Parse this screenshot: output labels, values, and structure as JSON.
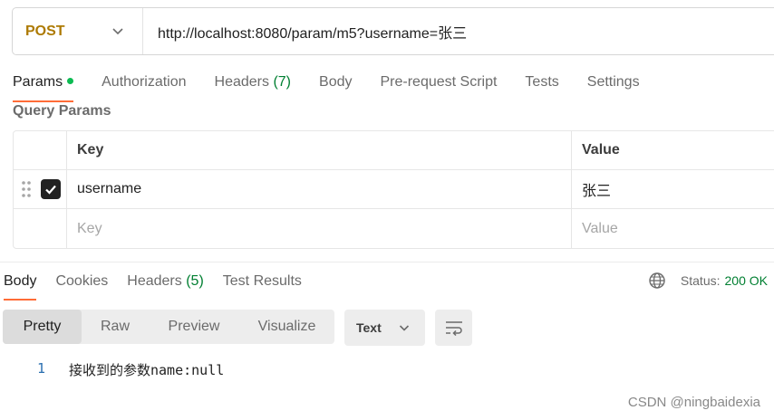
{
  "request": {
    "method": "POST",
    "url": "http://localhost:8080/param/m5?username=张三"
  },
  "request_tabs": [
    {
      "label": "Params",
      "active": true,
      "dot": true
    },
    {
      "label": "Authorization"
    },
    {
      "label": "Headers",
      "count": "(7)"
    },
    {
      "label": "Body"
    },
    {
      "label": "Pre-request Script"
    },
    {
      "label": "Tests"
    },
    {
      "label": "Settings"
    }
  ],
  "query_params": {
    "title": "Query Params",
    "columns": {
      "key": "Key",
      "value": "Value"
    },
    "rows": [
      {
        "checked": true,
        "key": "username",
        "value": "张三"
      }
    ],
    "placeholder": {
      "key": "Key",
      "value": "Value"
    }
  },
  "response_tabs": [
    {
      "label": "Body",
      "active": true
    },
    {
      "label": "Cookies"
    },
    {
      "label": "Headers",
      "count": "(5)"
    },
    {
      "label": "Test Results"
    }
  ],
  "status": {
    "label": "Status:",
    "value": "200 OK"
  },
  "format_options": [
    "Pretty",
    "Raw",
    "Preview",
    "Visualize"
  ],
  "format_active": "Pretty",
  "content_type": "Text",
  "response_body": [
    {
      "line": "1",
      "text": "接收到的参数name:null"
    }
  ],
  "watermark": "CSDN @ningbaidexia",
  "colors": {
    "accent": "#ff6c37",
    "method": "#ad7a03",
    "success": "#007f31",
    "dot": "#0cbb52"
  }
}
